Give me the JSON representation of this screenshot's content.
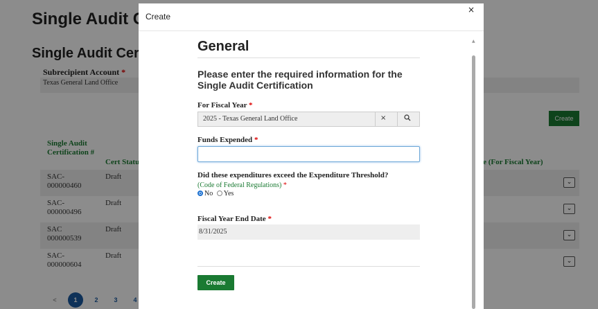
{
  "background": {
    "page_title": "Single Audit Certification",
    "section_title": "Single Audit Certification",
    "subrecipient_account_label": "Subrecipient Account",
    "required_marker": "*",
    "subrecipient_account_value": "Texas General Land Office",
    "create_button": "Create",
    "table": {
      "headers": [
        "Single Audit Certification #",
        "Cert Status",
        "Date (For Fiscal Year)"
      ],
      "rows": [
        {
          "id": "SAC-000000460",
          "status": "Draft"
        },
        {
          "id": "SAC-000000496",
          "status": "Draft"
        },
        {
          "id": "SAC 000000539",
          "status": "Draft"
        },
        {
          "id": "SAC-000000604",
          "status": "Draft"
        }
      ],
      "dropdown_glyph": "⌄"
    },
    "pagination": {
      "prev": "<",
      "pages": [
        "1",
        "2",
        "3",
        "4"
      ],
      "active_page": "1"
    }
  },
  "modal": {
    "title": "Create",
    "close_glyph": "×",
    "section_heading": "General",
    "intro": "Please enter the required information for the Single Audit Certification",
    "fiscal_year": {
      "label": "For Fiscal Year",
      "value": "2025 - Texas General Land Office",
      "clear_glyph": "×",
      "search_glyph": "🔍"
    },
    "funds_expended": {
      "label": "Funds Expended",
      "value": ""
    },
    "threshold": {
      "question": "Did these expenditures exceed the Expenditure Threshold?",
      "sublabel": "(Code of Federal Regulations)",
      "options": [
        "No",
        "Yes"
      ],
      "selected": "No"
    },
    "fiscal_year_end": {
      "label": "Fiscal Year End Date",
      "value": "8/31/2025"
    },
    "submit": "Create",
    "scroll_up_glyph": "▲"
  },
  "colors": {
    "accent_green": "#1a7a32",
    "link_blue": "#1a5aa0",
    "required_red": "#dd0000"
  }
}
